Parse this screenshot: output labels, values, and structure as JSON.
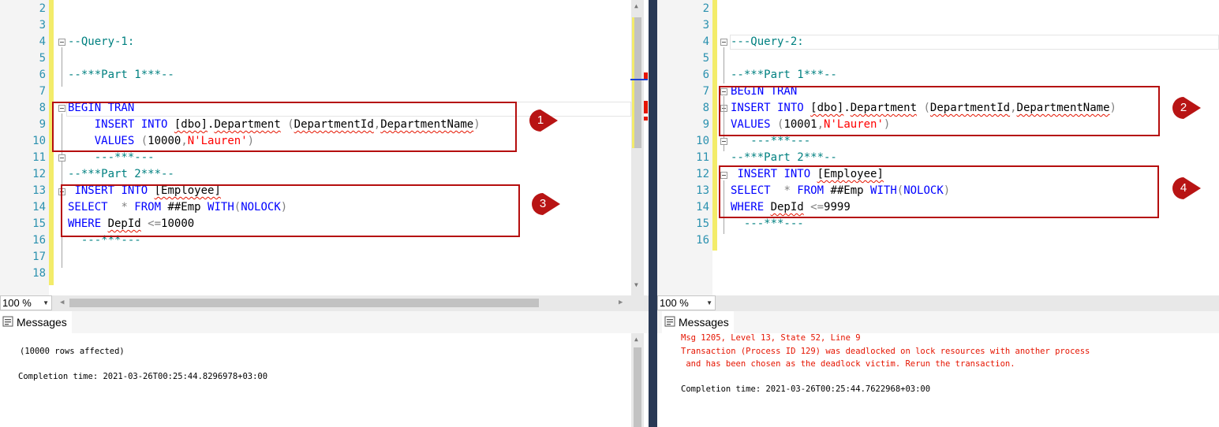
{
  "left": {
    "lines": [
      {
        "n": "2",
        "segs": []
      },
      {
        "n": "3",
        "segs": []
      },
      {
        "n": "4",
        "segs": [
          {
            "c": "cm",
            "t": "--Query-1:"
          }
        ]
      },
      {
        "n": "5",
        "segs": []
      },
      {
        "n": "6",
        "segs": [
          {
            "c": "cm",
            "t": "--***Part 1***--"
          }
        ]
      },
      {
        "n": "7",
        "segs": []
      },
      {
        "n": "8",
        "segs": [
          {
            "c": "kw",
            "t": "BEGIN TRAN"
          }
        ]
      },
      {
        "n": "9",
        "segs": [
          {
            "c": "pl",
            "t": "    "
          },
          {
            "c": "kw",
            "t": "INSERT INTO "
          },
          {
            "c": "pl sq",
            "t": "[dbo]"
          },
          {
            "c": "pl",
            "t": "."
          },
          {
            "c": "pl sq",
            "t": "Department"
          },
          {
            "c": "pl",
            "t": " "
          },
          {
            "c": "gr",
            "t": "("
          },
          {
            "c": "pl sq",
            "t": "DepartmentId"
          },
          {
            "c": "gr",
            "t": ","
          },
          {
            "c": "pl sq",
            "t": "DepartmentName"
          },
          {
            "c": "gr",
            "t": ")"
          }
        ]
      },
      {
        "n": "10",
        "segs": [
          {
            "c": "pl",
            "t": "    "
          },
          {
            "c": "kw",
            "t": "VALUES "
          },
          {
            "c": "gr",
            "t": "("
          },
          {
            "c": "pl",
            "t": "10000"
          },
          {
            "c": "gr",
            "t": ","
          },
          {
            "c": "str",
            "t": "N'Lauren'"
          },
          {
            "c": "gr",
            "t": ")"
          }
        ]
      },
      {
        "n": "11",
        "segs": [
          {
            "c": "pl",
            "t": "    "
          },
          {
            "c": "cm",
            "t": "---***---"
          }
        ]
      },
      {
        "n": "12",
        "segs": [
          {
            "c": "cm",
            "t": "--***Part 2***--"
          }
        ]
      },
      {
        "n": "13",
        "segs": [
          {
            "c": "pl",
            "t": " "
          },
          {
            "c": "kw",
            "t": "INSERT INTO "
          },
          {
            "c": "pl sq",
            "t": "[Employee]"
          }
        ]
      },
      {
        "n": "14",
        "segs": [
          {
            "c": "kw",
            "t": "SELECT  "
          },
          {
            "c": "gr",
            "t": "* "
          },
          {
            "c": "kw",
            "t": "FROM "
          },
          {
            "c": "pl",
            "t": "##Emp "
          },
          {
            "c": "kw",
            "t": "WITH"
          },
          {
            "c": "gr",
            "t": "("
          },
          {
            "c": "kw",
            "t": "NOLOCK"
          },
          {
            "c": "gr",
            "t": ")"
          }
        ]
      },
      {
        "n": "15",
        "segs": [
          {
            "c": "kw",
            "t": "WHERE "
          },
          {
            "c": "pl sq",
            "t": "DepId"
          },
          {
            "c": "pl",
            "t": " "
          },
          {
            "c": "gr",
            "t": "<="
          },
          {
            "c": "pl",
            "t": "10000"
          }
        ]
      },
      {
        "n": "16",
        "segs": [
          {
            "c": "pl",
            "t": "  "
          },
          {
            "c": "cm",
            "t": "---***---"
          }
        ]
      },
      {
        "n": "17",
        "segs": []
      },
      {
        "n": "18",
        "segs": []
      }
    ],
    "zoom": "100 %",
    "tab_label": "Messages",
    "messages": [
      "(10000 rows affected)",
      "Completion time: 2021-03-26T00:25:44.8296978+03:00"
    ]
  },
  "right": {
    "lines": [
      {
        "n": "2",
        "segs": []
      },
      {
        "n": "3",
        "segs": []
      },
      {
        "n": "4",
        "segs": [
          {
            "c": "cm",
            "t": "---Query-2:"
          }
        ]
      },
      {
        "n": "5",
        "segs": []
      },
      {
        "n": "6",
        "segs": [
          {
            "c": "cm",
            "t": "--***Part 1***--"
          }
        ]
      },
      {
        "n": "7",
        "segs": [
          {
            "c": "kw",
            "t": "BEGIN TRAN"
          }
        ]
      },
      {
        "n": "8",
        "segs": [
          {
            "c": "kw",
            "t": "INSERT INTO "
          },
          {
            "c": "pl sq",
            "t": "[dbo]"
          },
          {
            "c": "pl",
            "t": "."
          },
          {
            "c": "pl sq",
            "t": "Department"
          },
          {
            "c": "pl",
            "t": " "
          },
          {
            "c": "gr",
            "t": "("
          },
          {
            "c": "pl sq",
            "t": "DepartmentId"
          },
          {
            "c": "gr",
            "t": ","
          },
          {
            "c": "pl sq",
            "t": "DepartmentName"
          },
          {
            "c": "gr",
            "t": ")"
          }
        ]
      },
      {
        "n": "9",
        "segs": [
          {
            "c": "kw",
            "t": "VALUES "
          },
          {
            "c": "gr",
            "t": "("
          },
          {
            "c": "pl",
            "t": "10001"
          },
          {
            "c": "gr",
            "t": ","
          },
          {
            "c": "str",
            "t": "N'Lauren'"
          },
          {
            "c": "gr",
            "t": ")"
          }
        ]
      },
      {
        "n": "10",
        "segs": [
          {
            "c": "pl",
            "t": "   "
          },
          {
            "c": "cm",
            "t": "---***---"
          }
        ]
      },
      {
        "n": "11",
        "segs": [
          {
            "c": "cm",
            "t": "--***Part 2***--"
          }
        ]
      },
      {
        "n": "12",
        "segs": [
          {
            "c": "pl",
            "t": " "
          },
          {
            "c": "kw",
            "t": "INSERT INTO "
          },
          {
            "c": "pl sq",
            "t": "[Employee]"
          }
        ]
      },
      {
        "n": "13",
        "segs": [
          {
            "c": "kw",
            "t": "SELECT  "
          },
          {
            "c": "gr",
            "t": "* "
          },
          {
            "c": "kw",
            "t": "FROM "
          },
          {
            "c": "pl",
            "t": "##Emp "
          },
          {
            "c": "kw",
            "t": "WITH"
          },
          {
            "c": "gr",
            "t": "("
          },
          {
            "c": "kw",
            "t": "NOLOCK"
          },
          {
            "c": "gr",
            "t": ")"
          }
        ]
      },
      {
        "n": "14",
        "segs": [
          {
            "c": "kw",
            "t": "WHERE "
          },
          {
            "c": "pl sq",
            "t": "DepId"
          },
          {
            "c": "pl",
            "t": " "
          },
          {
            "c": "gr",
            "t": "<="
          },
          {
            "c": "pl",
            "t": "9999"
          }
        ]
      },
      {
        "n": "15",
        "segs": [
          {
            "c": "pl",
            "t": "  "
          },
          {
            "c": "cm",
            "t": "---***---"
          }
        ]
      },
      {
        "n": "16",
        "segs": []
      }
    ],
    "zoom": "100 %",
    "tab_label": "Messages",
    "messages": [
      {
        "kind": "error",
        "text": "Msg 1205, Level 13, State 52, Line 9"
      },
      {
        "kind": "error",
        "text": "Transaction (Process ID 129) was deadlocked on lock resources with another process"
      },
      {
        "kind": "error",
        "text": " and has been chosen as the deadlock victim. Rerun the transaction."
      },
      {
        "kind": "normal",
        "text": "Completion time: 2021-03-26T00:25:44.7622968+03:00"
      }
    ]
  },
  "callouts": [
    "1",
    "2",
    "3",
    "4"
  ],
  "colors": {
    "keyword": "#0000ff",
    "comment": "#008080",
    "string": "#ff0000",
    "error": "#e51400",
    "annotation": "#b50e0e",
    "line_number": "#2b91af"
  }
}
